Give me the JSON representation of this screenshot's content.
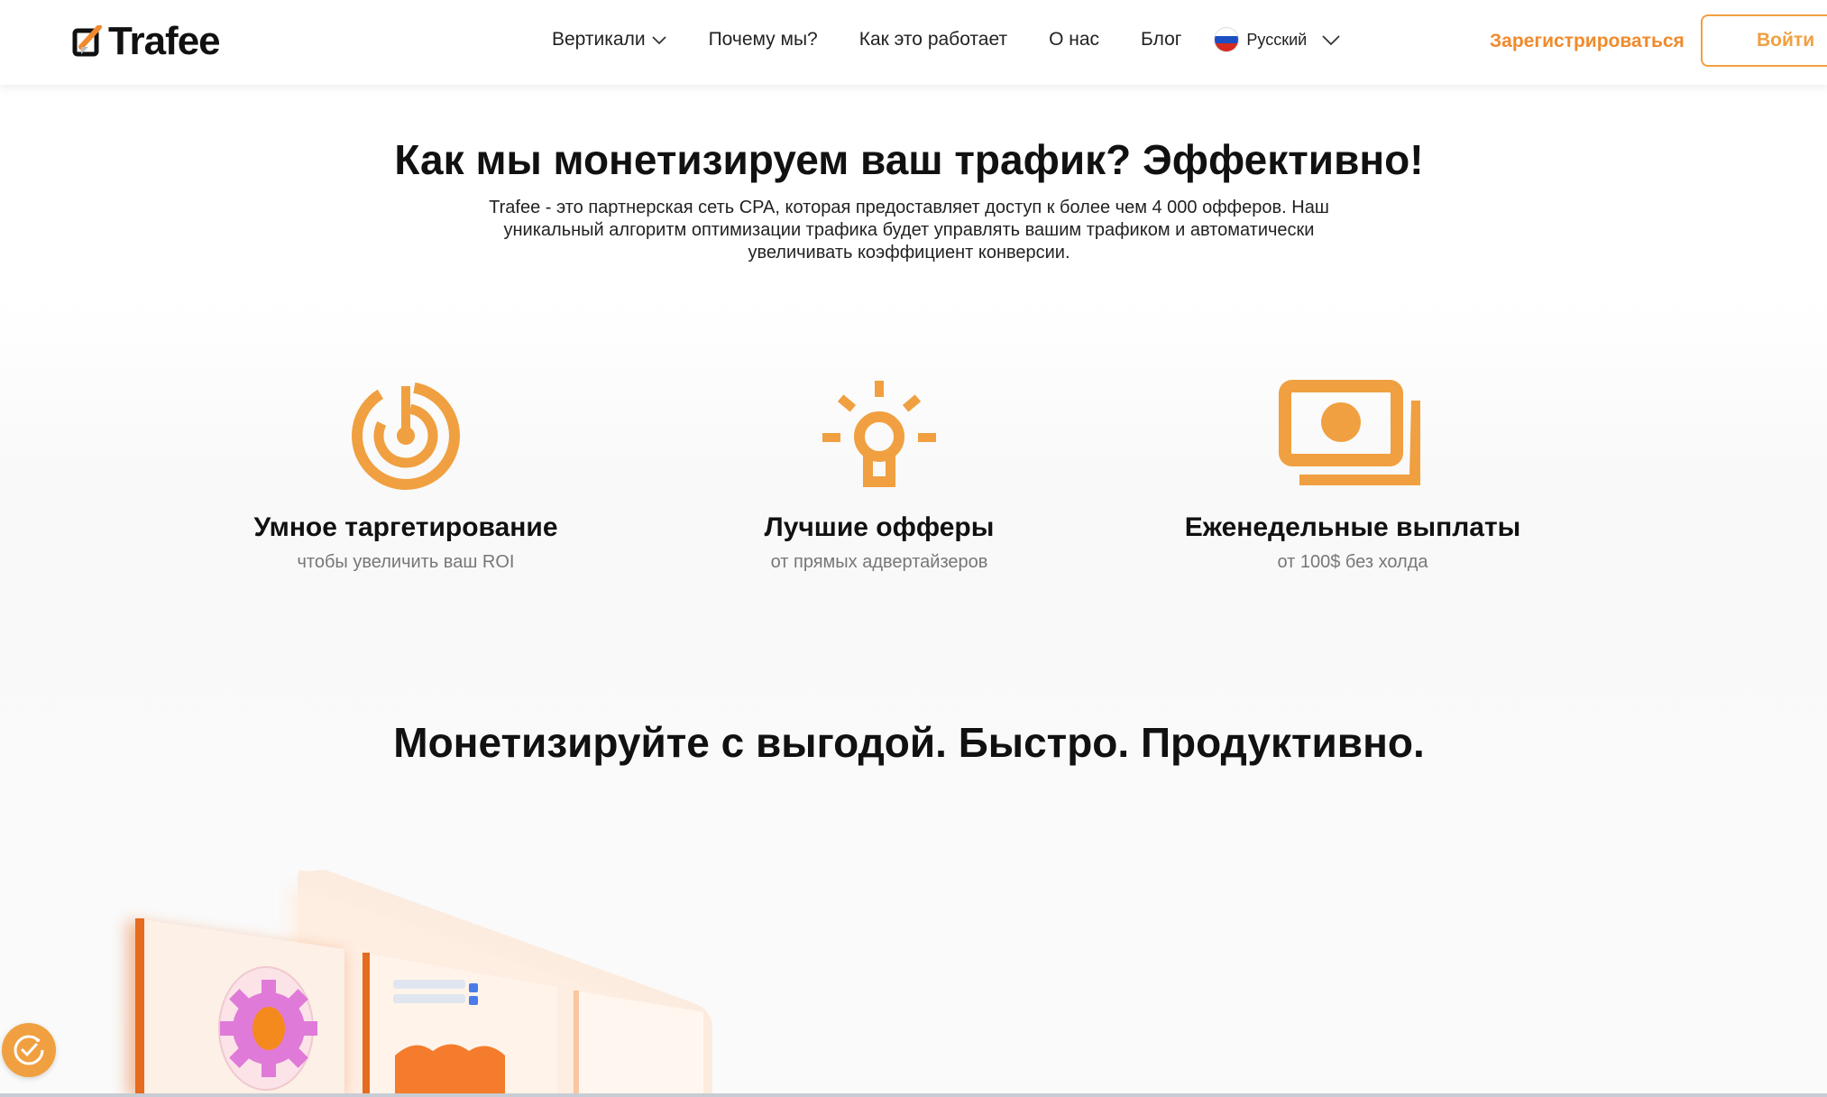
{
  "header": {
    "logo_text": "Trafee",
    "nav": [
      {
        "label": "Вертикали",
        "has_dropdown": true
      },
      {
        "label": "Почему мы?",
        "has_dropdown": false
      },
      {
        "label": "Как это работает",
        "has_dropdown": false
      },
      {
        "label": "О нас",
        "has_dropdown": false
      },
      {
        "label": "Блог",
        "has_dropdown": false
      }
    ],
    "language": "Русский",
    "register_label": "Зарегистрироваться",
    "login_label": "Войти"
  },
  "hero": {
    "title": "Как мы монетизируем ваш трафик? Эффективно!",
    "description_lines": [
      "Trafee - это партнерская сеть CPA, которая предоставляет доступ к более чем 4 000 офферов. Наш",
      "уникальный алгоритм оптимизации трафика будет управлять вашим трафиком и автоматически",
      "увеличивать коэффициент конверсии."
    ]
  },
  "features": [
    {
      "icon": "target-icon",
      "title": "Умное таргетирование",
      "subtitle": "чтобы увеличить ваш ROI"
    },
    {
      "icon": "lightbulb-icon",
      "title": "Лучшие офферы",
      "subtitle": "от прямых адвертайзеров"
    },
    {
      "icon": "money-icon",
      "title": "Еженедельные выплаты",
      "subtitle": "от 100$ без холда"
    }
  ],
  "section2": {
    "title": "Монетизируйте с выгодой. Быстро. Продуктивно."
  },
  "colors": {
    "accent": "#f0a040",
    "register": "#f08a2c",
    "text": "#111111",
    "muted": "#777777"
  }
}
